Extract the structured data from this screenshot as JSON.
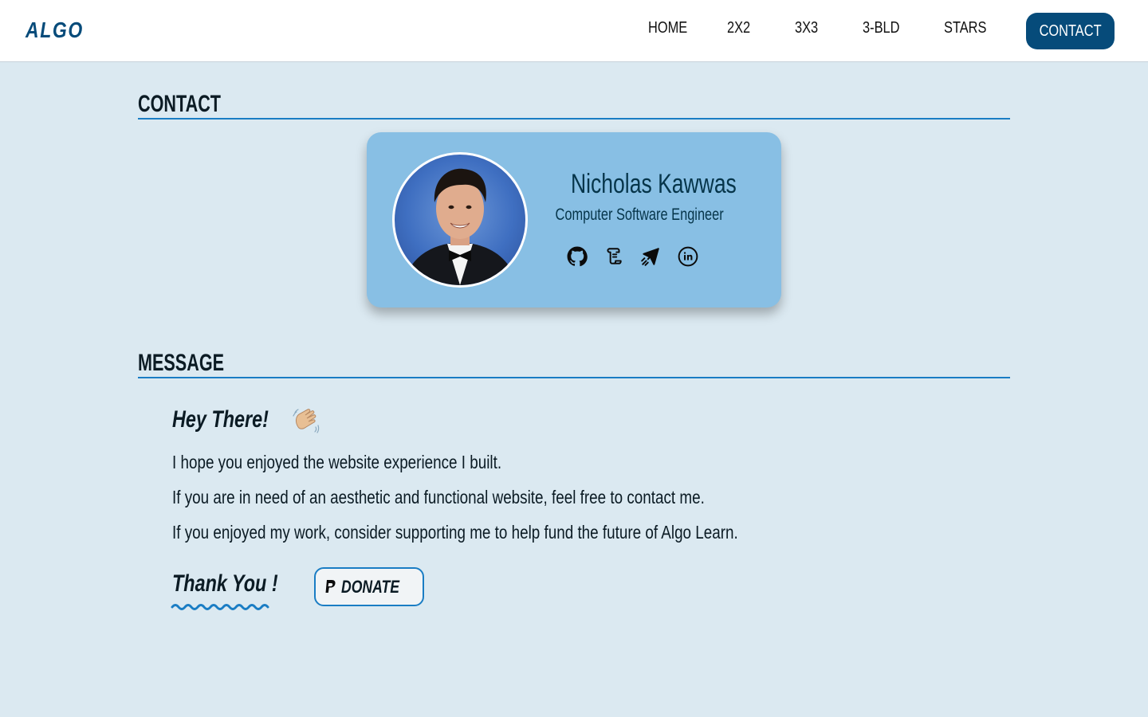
{
  "nav": {
    "logo": "ALGO",
    "links": [
      "HOME",
      "2X2",
      "3X3",
      "3-BLD",
      "STARS"
    ],
    "contact_button": "CONTACT"
  },
  "contact_section": {
    "title": "CONTACT",
    "card": {
      "name": "Nicholas Kawwas",
      "role": "Computer Software Engineer",
      "icons": [
        "github-icon",
        "resume-scroll-icon",
        "paper-plane-icon",
        "linkedin-icon"
      ]
    }
  },
  "message_section": {
    "title": "MESSAGE",
    "greeting": "Hey There!",
    "greeting_icon": "waving-hand-icon",
    "lines": [
      "I hope you enjoyed the website experience I built.",
      "If you are in need of an aesthetic and functional website, feel free to contact me.",
      "If you enjoyed my work, consider supporting me to help fund the future of Algo Learn."
    ],
    "thanks": "Thank You !",
    "donate_label": "DONATE",
    "donate_icon": "paypal-icon"
  },
  "colors": {
    "accent": "#064b7a",
    "link_blue": "#1a7dc4",
    "card_bg": "#88bfe4",
    "page_bg": "#dbe9f1"
  }
}
